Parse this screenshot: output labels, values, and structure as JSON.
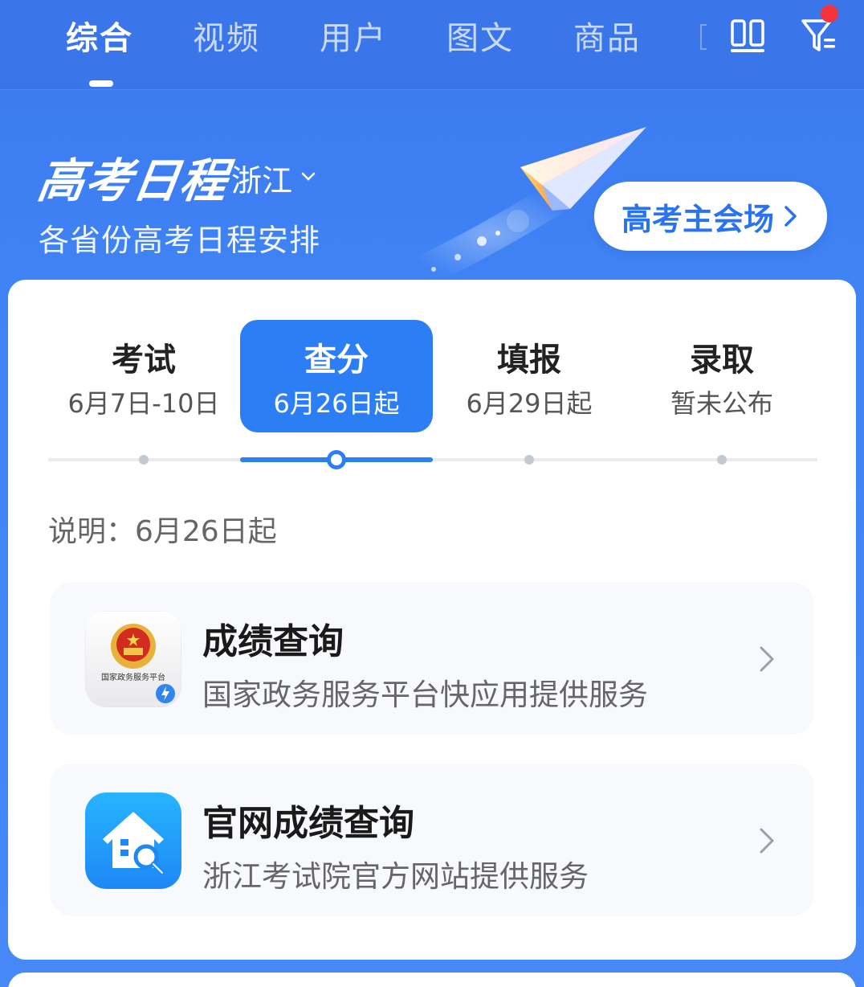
{
  "tabs": [
    {
      "label": "综合",
      "active": true
    },
    {
      "label": "视频",
      "active": false
    },
    {
      "label": "用户",
      "active": false
    },
    {
      "label": "图文",
      "active": false
    },
    {
      "label": "商品",
      "active": false
    }
  ],
  "toolbar": {
    "grid_icon": "grid-toggle-icon",
    "filter_icon": "filter-icon",
    "filter_badge_color": "#f4333c"
  },
  "banner": {
    "title": "高考日程",
    "province": "浙江",
    "subtitle": "各省份高考日程安排",
    "main_venue_label": "高考主会场"
  },
  "stages": [
    {
      "name": "考试",
      "date": "6月7日-10日",
      "active": false
    },
    {
      "name": "查分",
      "date": "6月26日起",
      "active": true
    },
    {
      "name": "填报",
      "date": "6月29日起",
      "active": false
    },
    {
      "name": "录取",
      "date": "暂未公布",
      "active": false
    }
  ],
  "note": "说明：6月26日起",
  "services": [
    {
      "title": "成绩查询",
      "desc": "国家政务服务平台快应用提供服务",
      "icon": "gov-service-platform-icon",
      "icon_text": "国家政务服务平台"
    },
    {
      "title": "官网成绩查询",
      "desc": "浙江考试院官方网站提供服务",
      "icon": "house-search-icon"
    }
  ],
  "colors": {
    "accent": "#2c7ef4",
    "background": "#3c7cf0"
  }
}
